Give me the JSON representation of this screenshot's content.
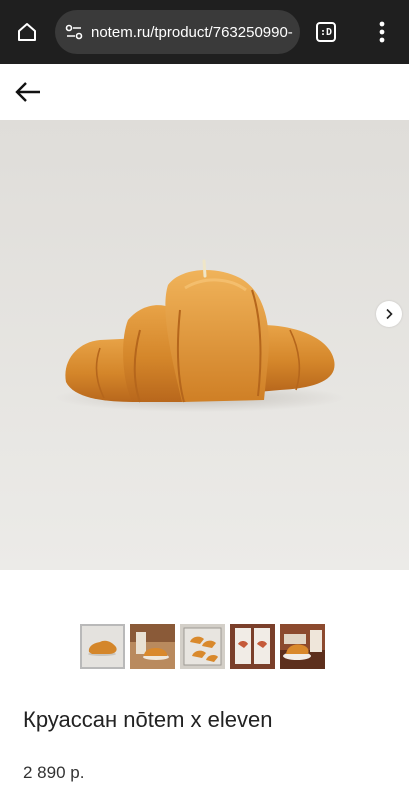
{
  "browser": {
    "url": "notem.ru/tproduct/763250990-",
    "tabs_label": ":D"
  },
  "product": {
    "title": "Круассан nōtem x eleven",
    "price": "2 890 р.",
    "thumbnail_count": 5,
    "active_thumbnail_index": 0
  },
  "colors": {
    "browser_bar": "#1f1f1f",
    "url_pill": "#3a3a3a",
    "hero_background": "#e6e4e0",
    "croissant": "#d98a2b"
  },
  "icons": [
    "home-icon",
    "site-info-icon",
    "tabs-icon",
    "more-vert-icon",
    "back-arrow-icon",
    "chevron-right-icon"
  ]
}
